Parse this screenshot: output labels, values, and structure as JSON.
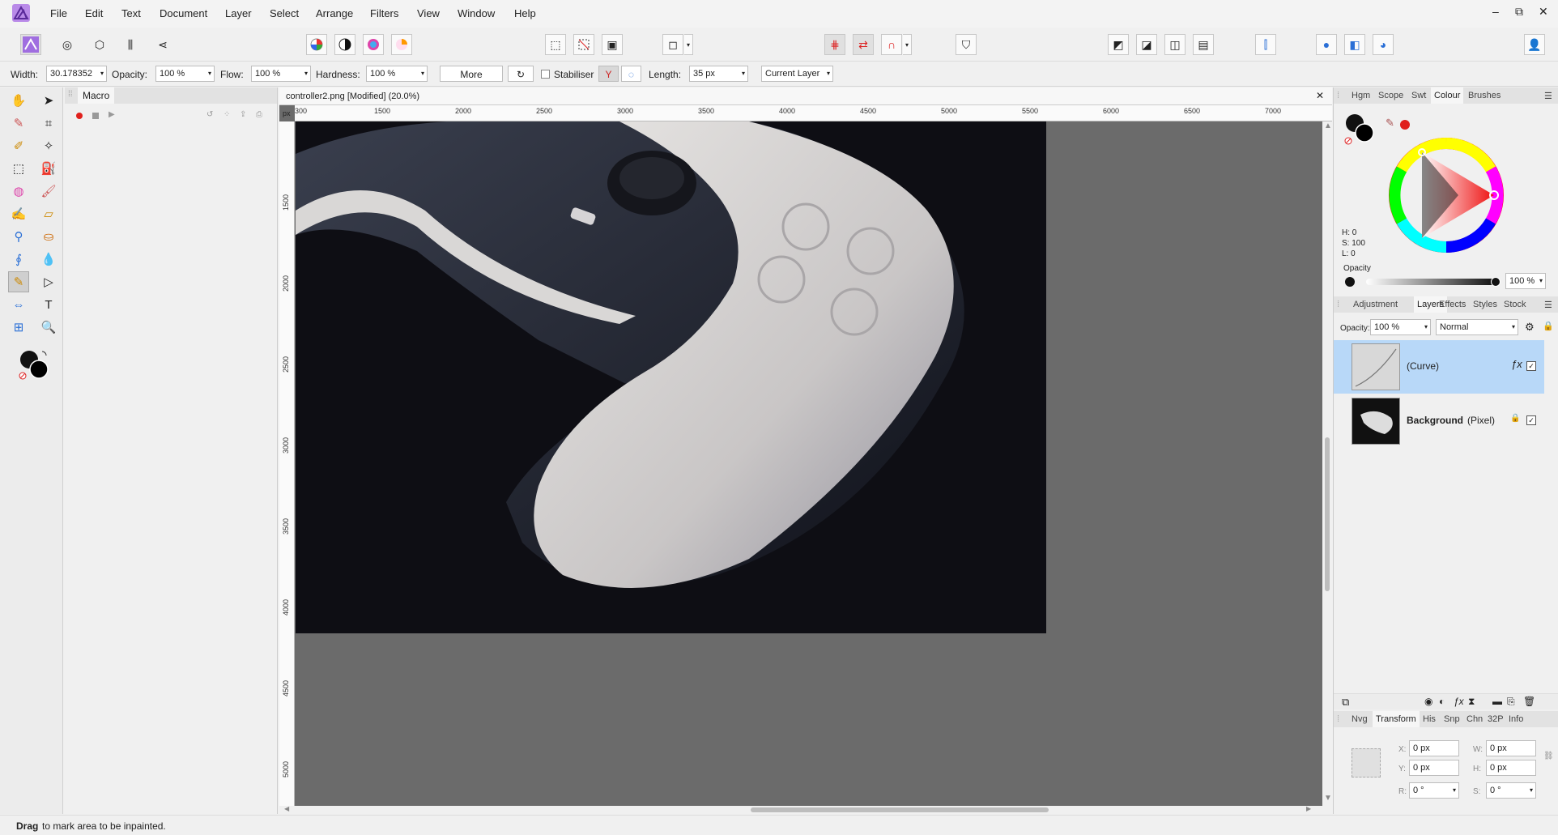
{
  "menu": [
    "File",
    "Edit",
    "Text",
    "Document",
    "Layer",
    "Select",
    "Arrange",
    "Filters",
    "View",
    "Window",
    "Help"
  ],
  "window_controls": {
    "minimize": "–",
    "restore": "⧉",
    "close": "✕"
  },
  "context": {
    "width_label": "Width:",
    "width_value": "30.178352",
    "opacity_label": "Opacity:",
    "opacity_value": "100 %",
    "flow_label": "Flow:",
    "flow_value": "100 %",
    "hardness_label": "Hardness:",
    "hardness_value": "100 %",
    "more_label": "More",
    "stabiliser_label": "Stabiliser",
    "length_label": "Length:",
    "length_value": "35 px",
    "layer_select": "Current Layer"
  },
  "macro": {
    "tab": "Macro"
  },
  "document": {
    "title": "controller2.png [Modified] (20.0%)",
    "ruler_unit": "px",
    "h_ticks": [
      "300",
      "1500",
      "2000",
      "2500",
      "3000",
      "3500",
      "4000",
      "4500",
      "5000",
      "5500",
      "6000",
      "6500",
      "7000"
    ],
    "v_ticks": [
      "1500",
      "2000",
      "2500",
      "3000",
      "3500",
      "4000",
      "4500",
      "5000"
    ]
  },
  "colour_panel": {
    "tabs": [
      "Hgm",
      "Scope",
      "Swt",
      "Colour",
      "Brushes"
    ],
    "active_tab": "Colour",
    "h": "H: 0",
    "s": "S: 100",
    "l": "L: 0",
    "opacity_label": "Opacity",
    "opacity_value": "100 %"
  },
  "layers_panel": {
    "tabs": [
      "Adjustment",
      "Layers",
      "Effects",
      "Styles",
      "Stock"
    ],
    "active_tab": "Layers",
    "opacity_label": "Opacity:",
    "opacity_value": "100 %",
    "blend_mode": "Normal",
    "layers": [
      {
        "name": "(Curve)",
        "selected": true
      },
      {
        "name": "Background",
        "type": "(Pixel)",
        "selected": false
      }
    ]
  },
  "transform_panel": {
    "tabs": [
      "Nvg",
      "Transform",
      "His",
      "Snp",
      "Chn",
      "32P",
      "Info"
    ],
    "active_tab": "Transform",
    "x_label": "X:",
    "x": "0 px",
    "y_label": "Y:",
    "y": "0 px",
    "w_label": "W:",
    "w": "0 px",
    "h_label": "H:",
    "h": "0 px",
    "r_label": "R:",
    "r": "0 °",
    "s_label": "S:",
    "s": "0 °"
  },
  "status": {
    "bold": "Drag",
    "text": "to mark area to be inpainted."
  },
  "colors": {
    "accent": "#8e4fd0",
    "selected_layer": "#b8d8f8",
    "canvas_bg": "#6b6b6b",
    "record": "#e0201c"
  }
}
